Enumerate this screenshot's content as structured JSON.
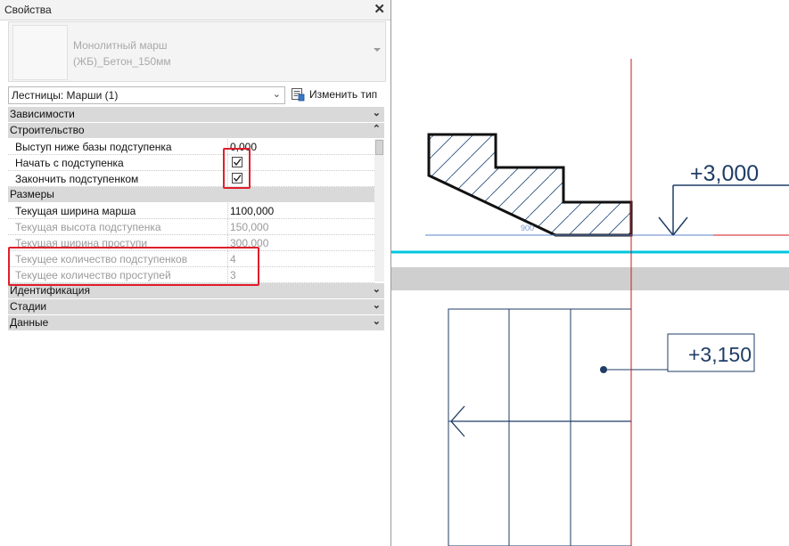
{
  "panel": {
    "title": "Свойства",
    "close_icon": "close-icon"
  },
  "type_selector": {
    "name_line1": "Монолитный марш",
    "name_line2": "(ЖБ)_Бетон_150мм"
  },
  "filter": {
    "selected": "Лестницы: Марши (1)"
  },
  "edit_type": {
    "label": "Изменить тип",
    "icon": "edit-type-icon"
  },
  "groups": {
    "dependencies": "Зависимости",
    "construction": "Строительство",
    "dimensions": "Размеры",
    "identity": "Идентификация",
    "phasing": "Стадии",
    "data": "Данные"
  },
  "construction_rows": [
    {
      "name": "Выступ ниже базы подступенка",
      "value": "0,000"
    },
    {
      "name": "Начать с подступенка",
      "checked": true
    },
    {
      "name": "Закончить подступенком",
      "checked": true
    }
  ],
  "dimension_rows": [
    {
      "name": "Текущая ширина марша",
      "value": "1100,000",
      "readonly": false
    },
    {
      "name": "Текущая высота подступенка",
      "value": "150,000",
      "readonly": true
    },
    {
      "name": "Текущая ширина проступи",
      "value": "300,000",
      "readonly": true
    },
    {
      "name": "Текущее количество подступенков",
      "value": "4",
      "readonly": true
    },
    {
      "name": "Текущее количество проступей",
      "value": "3",
      "readonly": true
    }
  ],
  "drawing": {
    "elevation_top": "+3,000",
    "elevation_bottom": "+3,150",
    "small_label": "900",
    "colors": {
      "section_line": "#d0141e",
      "level_line": "#00c8e0",
      "plan_lines": "#1f3d66",
      "tag_text": "#1f3d66"
    }
  }
}
